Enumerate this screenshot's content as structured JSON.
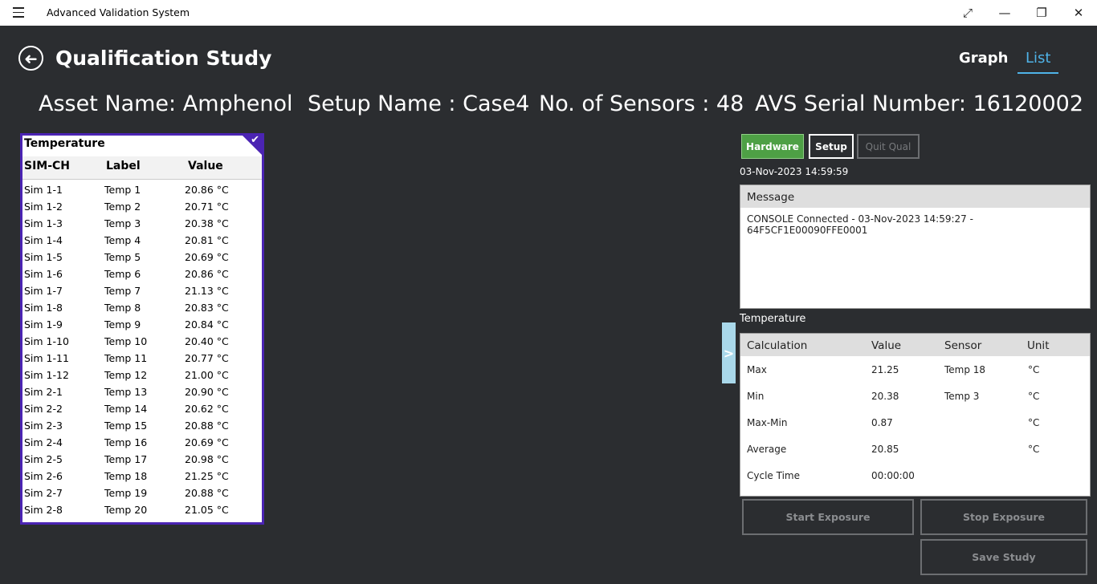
{
  "app": {
    "title": "Advanced Validation System"
  },
  "window_controls": {
    "fullscreen": "⤢",
    "minimize": "—",
    "restore": "❐",
    "close": "✕"
  },
  "header": {
    "back_glyph": "➜",
    "title": "Qualification Study",
    "tabs": [
      {
        "label": "Graph"
      },
      {
        "label": "List"
      }
    ],
    "active_tab": "List"
  },
  "info": {
    "asset": "Asset Name: Amphenol",
    "setup": "Setup Name : Case4",
    "sensors": "No. of Sensors : 48",
    "serial": "AVS Serial Number:  16120002"
  },
  "sensor_card": {
    "title": "Temperature",
    "columns": [
      "SIM-CH",
      "Label",
      "Value"
    ],
    "rows": [
      [
        "Sim 1-1",
        "Temp 1",
        "20.86 °C"
      ],
      [
        "Sim 1-2",
        "Temp 2",
        "20.71 °C"
      ],
      [
        "Sim 1-3",
        "Temp 3",
        "20.38 °C"
      ],
      [
        "Sim 1-4",
        "Temp 4",
        "20.81 °C"
      ],
      [
        "Sim 1-5",
        "Temp 5",
        "20.69 °C"
      ],
      [
        "Sim 1-6",
        "Temp 6",
        "20.86 °C"
      ],
      [
        "Sim 1-7",
        "Temp 7",
        "21.13 °C"
      ],
      [
        "Sim 1-8",
        "Temp 8",
        "20.83 °C"
      ],
      [
        "Sim 1-9",
        "Temp 9",
        "20.84 °C"
      ],
      [
        "Sim 1-10",
        "Temp 10",
        "20.40 °C"
      ],
      [
        "Sim 1-11",
        "Temp 11",
        "20.77 °C"
      ],
      [
        "Sim 1-12",
        "Temp 12",
        "21.00 °C"
      ],
      [
        "Sim 2-1",
        "Temp 13",
        "20.90 °C"
      ],
      [
        "Sim 2-2",
        "Temp 14",
        "20.62 °C"
      ],
      [
        "Sim 2-3",
        "Temp 15",
        "20.88 °C"
      ],
      [
        "Sim 2-4",
        "Temp 16",
        "20.69 °C"
      ],
      [
        "Sim 2-5",
        "Temp 17",
        "20.98 °C"
      ],
      [
        "Sim 2-6",
        "Temp 18",
        "21.25 °C"
      ],
      [
        "Sim 2-7",
        "Temp 19",
        "20.88 °C"
      ],
      [
        "Sim 2-8",
        "Temp 20",
        "21.05 °C"
      ]
    ]
  },
  "controls": {
    "hardware": "Hardware",
    "setup": "Setup",
    "quit": "Quit Qual"
  },
  "timestamp": "03-Nov-2023 14:59:59",
  "message": {
    "header": "Message",
    "text": "CONSOLE Connected - 03-Nov-2023 14:59:27 - 64F5CF1E00090FFE0001"
  },
  "calc": {
    "label": "Temperature",
    "columns": [
      "Calculation",
      "Value",
      "Sensor",
      "Unit"
    ],
    "rows": [
      [
        "Max",
        "21.25",
        "Temp 18",
        "°C"
      ],
      [
        "Min",
        "20.38",
        "Temp 3",
        "°C"
      ],
      [
        "Max-Min",
        "0.87",
        "",
        "°C"
      ],
      [
        "Average",
        "20.85",
        "",
        "°C"
      ],
      [
        "Cycle Time",
        "00:00:00",
        "",
        ""
      ]
    ]
  },
  "side_toggle": ">",
  "actions": {
    "start": "Start Exposure",
    "stop": "Stop Exposure",
    "save": "Save Study"
  }
}
